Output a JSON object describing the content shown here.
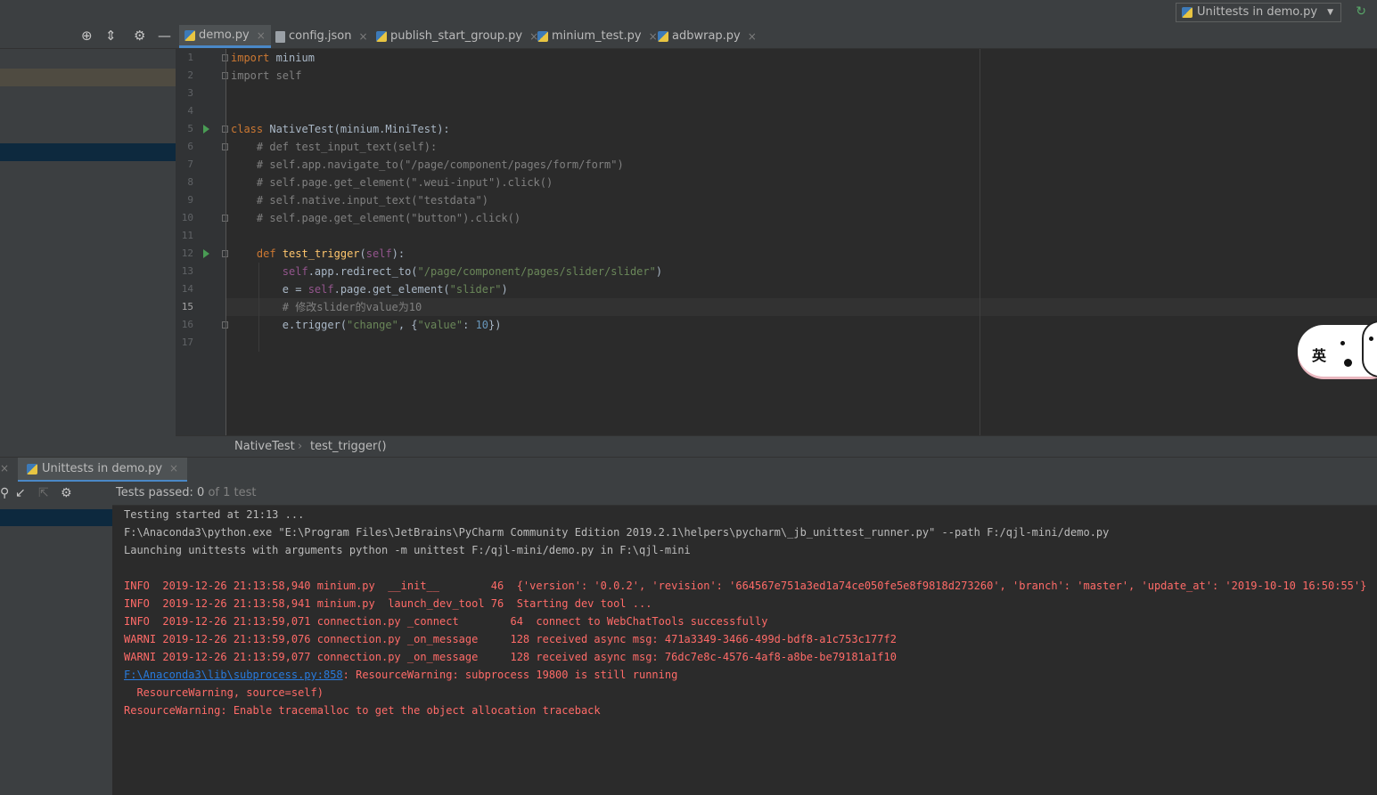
{
  "run_config": {
    "label": "Unittests in demo.py"
  },
  "tabs": [
    {
      "label": "demo.py",
      "icon": "python-file-icon",
      "active": true
    },
    {
      "label": "config.json",
      "icon": "json-file-icon",
      "active": false
    },
    {
      "label": "publish_start_group.py",
      "icon": "python-file-icon",
      "active": false
    },
    {
      "label": "minium_test.py",
      "icon": "python-file-icon",
      "active": false
    },
    {
      "label": "adbwrap.py",
      "icon": "python-file-icon",
      "active": false
    }
  ],
  "editor": {
    "line_numbers": [
      "1",
      "2",
      "3",
      "4",
      "5",
      "6",
      "7",
      "8",
      "9",
      "10",
      "11",
      "12",
      "13",
      "14",
      "15",
      "16",
      "17"
    ],
    "current_line": "15",
    "code": {
      "l1_kw": "import",
      "l1_rest": " minium",
      "l2": "import self",
      "l5_kw": "class",
      "l5_rest": " NativeTest(minium.MiniTest):",
      "l6": "    # def test_input_text(self):",
      "l7": "    # self.app.navigate_to(\"/page/component/pages/form/form\")",
      "l8": "    # self.page.get_element(\".weui-input\").click()",
      "l9": "    # self.native.input_text(\"testdata\")",
      "l10": "    # self.page.get_element(\"button\").click()",
      "l12_kw": "def",
      "l12_fn": "test_trigger",
      "l12_self": "self",
      "l12_end": "):",
      "l13_self": "self",
      "l13_mid": ".app.redirect_to(",
      "l13_str": "\"/page/component/pages/slider/slider\"",
      "l13_end": ")",
      "l14_a": "e = ",
      "l14_self": "self",
      "l14_mid": ".page.get_element(",
      "l14_str": "\"slider\"",
      "l14_end": ")",
      "l15": "# 修改slider的value为10",
      "l16_a": "e.trigger(",
      "l16_s1": "\"change\"",
      "l16_b": ", {",
      "l16_s2": "\"value\"",
      "l16_c": ": ",
      "l16_num": "10",
      "l16_d": "})"
    }
  },
  "breadcrumb": {
    "class": "NativeTest",
    "sep": "›",
    "method": "test_trigger()"
  },
  "run_panel": {
    "tab_label": "Unittests in demo.py",
    "status_prefix": "Tests passed: ",
    "status_count": "0",
    "status_suffix": " of 1 test"
  },
  "console": {
    "l1": "Testing started at 21:13 ...",
    "l2": "F:\\Anaconda3\\python.exe \"E:\\Program Files\\JetBrains\\PyCharm Community Edition 2019.2.1\\helpers\\pycharm\\_jb_unittest_runner.py\" --path F:/qjl-mini/demo.py",
    "l3": "Launching unittests with arguments python -m unittest F:/qjl-mini/demo.py in F:\\qjl-mini",
    "l4": "INFO  2019-12-26 21:13:58,940 minium.py  __init__        46  {'version': '0.0.2', 'revision': '664567e751a3ed1a74ce050fe5e8f9818d273260', 'branch': 'master', 'update_at': '2019-10-10 16:50:55'}",
    "l5": "INFO  2019-12-26 21:13:58,941 minium.py  launch_dev_tool 76  Starting dev tool ...",
    "l6": "INFO  2019-12-26 21:13:59,071 connection.py _connect        64  connect to WebChatTools successfully",
    "l7": "WARNI 2019-12-26 21:13:59,076 connection.py _on_message     128 received async msg: 471a3349-3466-499d-bdf8-a1c753c177f2",
    "l8": "WARNI 2019-12-26 21:13:59,077 connection.py _on_message     128 received async msg: 76dc7e8c-4576-4af8-a8be-be79181a1f10",
    "l9_link": "F:\\Anaconda3\\lib\\subprocess.py:858",
    "l9_rest": ": ResourceWarning: subprocess 19800 is still running",
    "l10": "  ResourceWarning, source=self)",
    "l11": "ResourceWarning: Enable tracemalloc to get the object allocation traceback"
  },
  "sticker": {
    "char": "英"
  },
  "colors": {
    "accent": "#4a88c7",
    "error": "#ff6b68",
    "link": "#287bde",
    "run_green": "#499c54"
  }
}
